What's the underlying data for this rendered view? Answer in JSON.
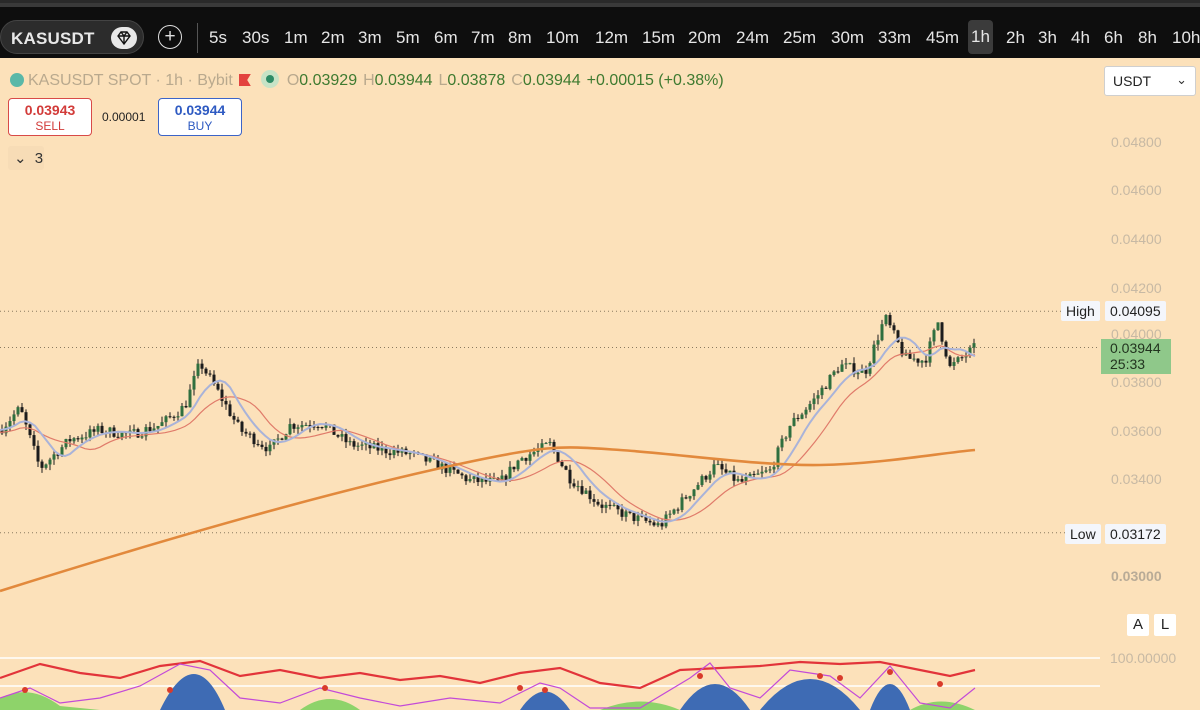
{
  "toolbar": {
    "symbol": "KASUSDT",
    "add_label": "+",
    "timeframes": [
      "5s",
      "30s",
      "1m",
      "2m",
      "3m",
      "5m",
      "6m",
      "7m",
      "8m",
      "10m",
      "12m",
      "15m",
      "20m",
      "24m",
      "25m",
      "30m",
      "33m",
      "45m",
      "1h",
      "2h",
      "3h",
      "4h",
      "6h",
      "8h",
      "10h"
    ],
    "active_timeframe": "1h"
  },
  "legend": {
    "title": "KASUSDT SPOT · 1h · Bybit",
    "open_key": "O",
    "open": "0.03929",
    "high_key": "H",
    "high": "0.03944",
    "low_key": "L",
    "low": "0.03878",
    "close_key": "C",
    "close": "0.03944",
    "change": "+0.00015 (+0.38%)"
  },
  "currency_select": {
    "value": "USDT"
  },
  "trade": {
    "sell_price": "0.03943",
    "sell_label": "SELL",
    "spread": "0.00001",
    "buy_price": "0.03944",
    "buy_label": "BUY"
  },
  "indicators_toggle": {
    "count": "3"
  },
  "price_axis": {
    "labels": [
      "0.04800",
      "0.04600",
      "0.04400",
      "0.04200",
      "0.04000",
      "0.03800",
      "0.03600",
      "0.03400",
      "0.03000"
    ],
    "high_tag": "High",
    "high_value": "0.04095",
    "low_tag": "Low",
    "low_value": "0.03172",
    "current_price": "0.03944",
    "countdown": "25:33"
  },
  "scale_buttons": {
    "auto": "A",
    "log": "L"
  },
  "oscillator": {
    "max_label": "100.00000"
  },
  "colors": {
    "background": "#fce1ba",
    "candle_up": "#2f6f3f",
    "candle_down": "#1c1c1c",
    "ma_long": "#e2893c",
    "ma_mid": "#a9b3d9",
    "ma_short": "#e07b6a",
    "osc_red": "#e2343a",
    "osc_magenta": "#c34ad8",
    "osc_blue": "#3e6bb4",
    "osc_green": "#8ed36a"
  }
}
